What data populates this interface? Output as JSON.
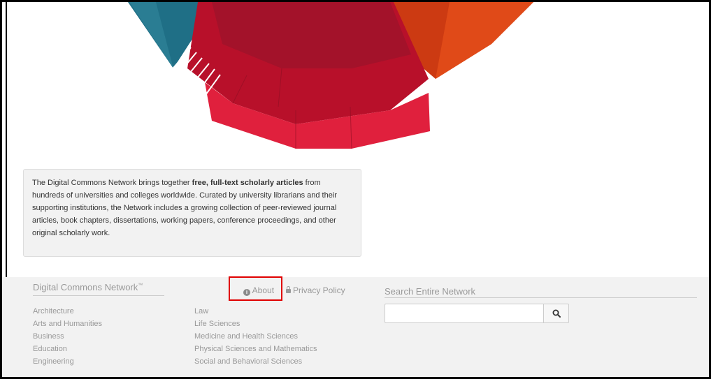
{
  "intro": {
    "text_1": "The Digital Commons Network brings together ",
    "text_bold": "free, full-text scholarly articles",
    "text_2": " from hundreds of universities and colleges worldwide. Curated by university librarians and their supporting institutions, the Network includes a growing collection of peer-reviewed journal articles, book chapters, dissertations, working papers, conference proceedings, and other original scholarly work."
  },
  "footer": {
    "brand": "Digital Commons Network",
    "brand_tm": "™",
    "about": "About",
    "privacy": "Privacy Policy",
    "disciplines_col1": [
      "Architecture",
      "Arts and Humanities",
      "Business",
      "Education",
      "Engineering"
    ],
    "disciplines_col2": [
      "Law",
      "Life Sciences",
      "Medicine and Health Sciences",
      "Physical Sciences and Mathematics",
      "Social and Behavioral Sciences"
    ],
    "search_title": "Search Entire Network",
    "search_value": ""
  },
  "icons": {
    "about": "info-circle-icon",
    "privacy": "lock-icon",
    "search": "search-icon"
  },
  "colors": {
    "teal": "#1f6f86",
    "dark_red": "#a3122a",
    "red": "#d01a35",
    "bright_red": "#e0203d",
    "orange": "#e04a18",
    "highlight": "#e00000"
  }
}
